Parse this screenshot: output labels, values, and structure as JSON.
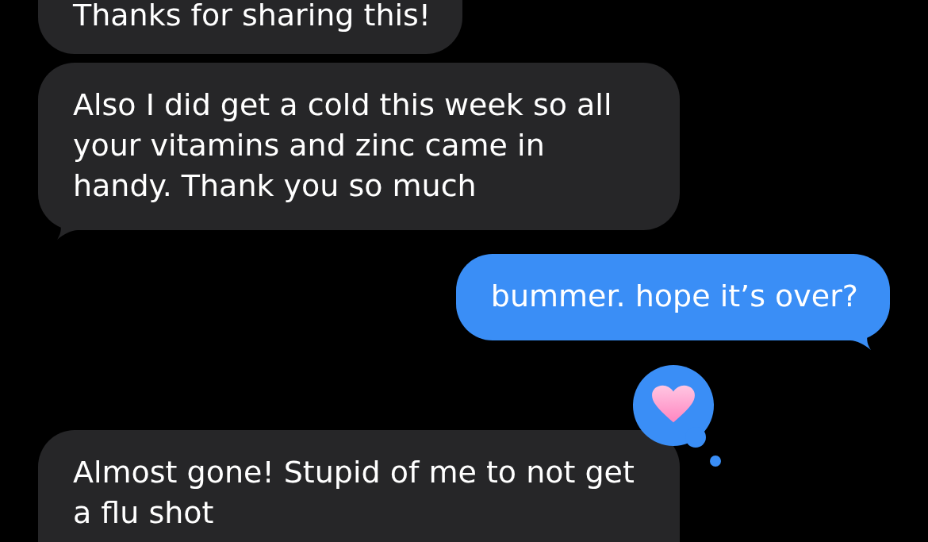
{
  "messages": [
    {
      "kind": "received",
      "text": "Thanks for sharing this!",
      "tail": false,
      "tapback": false
    },
    {
      "kind": "received",
      "text": "Also I did get a cold this week so all your vitamins and zinc came in handy. Thank you so much",
      "tail": true,
      "tapback": false
    },
    {
      "kind": "sent",
      "text": "bummer. hope it’s over?",
      "tail": true,
      "tapback": false
    },
    {
      "kind": "received",
      "text": "Almost gone! Stupid of me to not get a flu shot",
      "tail": false,
      "tapback": true
    }
  ]
}
